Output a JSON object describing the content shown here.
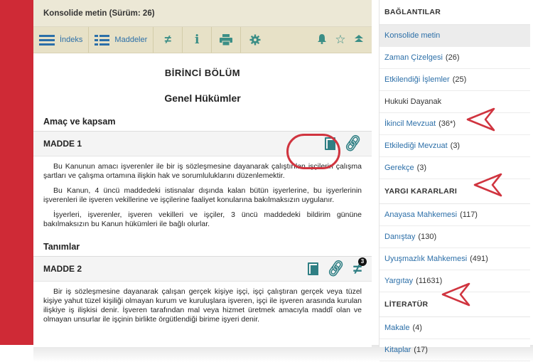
{
  "document": {
    "title": "Konsolide metin (Sürüm: 26)",
    "toolbar": {
      "index_label": "İndeks",
      "items_label": "Maddeler"
    },
    "part_title": "BİRİNCİ BÖLÜM",
    "chapter_title": "Genel Hükümler",
    "sections": [
      {
        "heading": "Amaç ve kapsam",
        "article": "MADDE 1",
        "paragraphs": [
          "Bu Kanunun amacı işverenler ile bir iş sözleşmesine dayanarak çalıştırılan işçilerin çalışma şartları ve çalışma ortamına ilişkin hak ve sorumluluklarını düzenlemektir.",
          "Bu Kanun, 4 üncü maddedeki istisnalar dışında kalan bütün işyerlerine, bu işyerlerinin işverenleri ile işveren vekillerine ve işçilerine faaliyet konularına bakılmaksızın uygulanır.",
          "İşyerleri, işverenler, işveren vekilleri ve işçiler, 3 üncü maddedeki bildirim gününe bakılmaksızın bu Kanun hükümleri ile bağlı olurlar."
        ]
      },
      {
        "heading": "Tanımlar",
        "article": "MADDE 2",
        "badge": "3",
        "paragraphs": [
          "Bir iş sözleşmesine dayanarak çalışan gerçek kişiye işçi, işçi çalıştıran gerçek veya tüzel kişiye yahut tüzel kişiliği olmayan kurum ve kuruluşlara işveren, işçi ile işveren arasında kurulan ilişkiye iş ilişkisi denir. İşveren tarafından mal veya hizmet üretmek amacıyla maddî olan ve olmayan unsurlar ile işçinin birlikte örgütlendiği birime işyeri denir."
        ]
      }
    ]
  },
  "sidebar": {
    "groups": [
      {
        "heading": "BAĞLANTILAR",
        "items": [
          {
            "label": "Konsolide metin",
            "count": "",
            "active": true
          },
          {
            "label": "Zaman Çizelgesi",
            "count": "(26)"
          },
          {
            "label": "Etkilendiği İşlemler",
            "count": "(25)"
          },
          {
            "label": "Hukuki Dayanak",
            "count": "",
            "plain": true
          },
          {
            "label": "İkincil Mevzuat",
            "count": "(36*)"
          },
          {
            "label": "Etkilediği Mevzuat",
            "count": "(3)"
          },
          {
            "label": "Gerekçe",
            "count": "(3)"
          }
        ]
      },
      {
        "heading": "YARGI KARARLARI",
        "items": [
          {
            "label": "Anayasa Mahkemesi",
            "count": "(117)"
          },
          {
            "label": "Danıştay",
            "count": "(130)"
          },
          {
            "label": "Uyuşmazlık Mahkemesi",
            "count": "(491)"
          },
          {
            "label": "Yargıtay",
            "count": "(11631)"
          }
        ]
      },
      {
        "heading": "LİTERATÜR",
        "items": [
          {
            "label": "Makale",
            "count": "(4)"
          },
          {
            "label": "Kitaplar",
            "count": "(17)"
          }
        ]
      }
    ]
  },
  "colors": {
    "accent_red": "#cf2a36",
    "toolbar_bg": "#e7e1c7",
    "link_blue": "#2c6fa8",
    "icon_teal": "#2f7f84"
  }
}
